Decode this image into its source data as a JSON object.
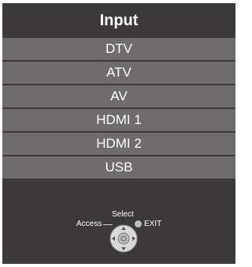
{
  "header": {
    "title": "Input"
  },
  "menu": {
    "items": [
      "DTV",
      "ATV",
      "AV",
      "HDMI 1",
      "HDMI 2",
      "USB"
    ]
  },
  "legend": {
    "select": "Select",
    "access": "Access",
    "exit": "EXIT"
  },
  "colors": {
    "panel": "#3b3939",
    "item": "#6e6c6c",
    "text": "#ffffff"
  }
}
